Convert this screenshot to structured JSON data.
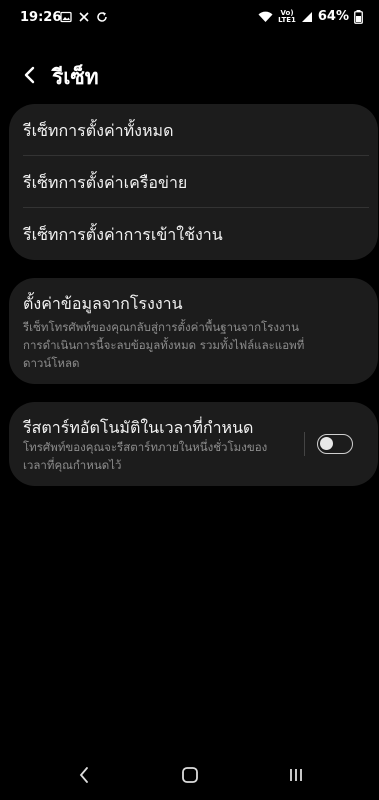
{
  "status_bar": {
    "time": "19:26",
    "left_icons": [
      "gallery-icon",
      "missed-call-icon",
      "sync-icon"
    ],
    "network_label_top": "Vo)",
    "network_label_bottom": "LTE1",
    "battery": "64%"
  },
  "header": {
    "title": "รีเซ็ท",
    "back_icon": "chevron-left-icon"
  },
  "reset_options": [
    "รีเซ็ทการตั้งค่าทั้งหมด",
    "รีเซ็ทการตั้งค่าเครือข่าย",
    "รีเซ็ทการตั้งค่าการเข้าใช้งาน"
  ],
  "factory_reset": {
    "title": "ตั้งค่าข้อมูลจากโรงงาน",
    "description_lines": [
      "รีเซ็ทโทรศัพท์ของคุณกลับสู่การตั้งค่าพื้นฐานจากโรงงาน",
      "การดำเนินการนี้จะลบข้อมูลทั้งหมด รวมทั้งไฟล์และแอพที่",
      "ดาวน์โหลด"
    ]
  },
  "auto_restart": {
    "title": "รีสตาร์ทอัตโนมัติในเวลาที่กำหนด",
    "description_lines": [
      "โทรศัพท์ของคุณจะรีสตาร์ทภายในหนึ่งชั่วโมงของ",
      "เวลาที่คุณกำหนดไว้"
    ],
    "toggle_on": false
  },
  "nav_bar": {
    "icons": [
      "back-nav-icon",
      "home-nav-icon",
      "recents-nav-icon"
    ]
  },
  "colors": {
    "background": "#000000",
    "card": "#1c1c1c",
    "primary_text": "#f2f2f2",
    "secondary_text": "#8d8d8d"
  }
}
